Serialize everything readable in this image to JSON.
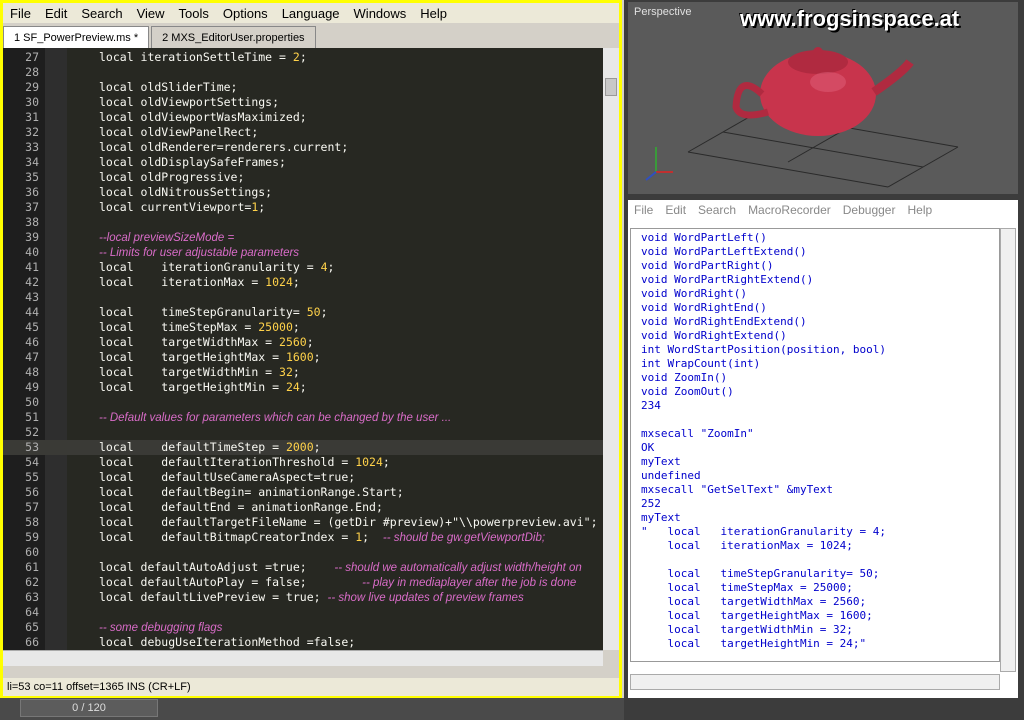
{
  "menubar": [
    "File",
    "Edit",
    "Search",
    "View",
    "Tools",
    "Options",
    "Language",
    "Windows",
    "Help"
  ],
  "tabs": [
    {
      "label": "1 SF_PowerPreview.ms *"
    },
    {
      "label": "2 MXS_EditorUser.properties"
    }
  ],
  "editor_lines": [
    {
      "n": "27",
      "c": "local iterationSettleTime = 2;"
    },
    {
      "n": "28",
      "c": ""
    },
    {
      "n": "29",
      "c": "local oldSliderTime;"
    },
    {
      "n": "30",
      "c": "local oldViewportSettings;"
    },
    {
      "n": "31",
      "c": "local oldViewportWasMaximized;"
    },
    {
      "n": "32",
      "c": "local oldViewPanelRect;"
    },
    {
      "n": "33",
      "c": "local oldRenderer=renderers.current;"
    },
    {
      "n": "34",
      "c": "local oldDisplaySafeFrames;"
    },
    {
      "n": "35",
      "c": "local oldProgressive;"
    },
    {
      "n": "36",
      "c": "local oldNitrousSettings;"
    },
    {
      "n": "37",
      "c": "local currentViewport=1;"
    },
    {
      "n": "38",
      "c": ""
    },
    {
      "n": "39",
      "c": "--local previewSizeMode ="
    },
    {
      "n": "40",
      "c": "-- Limits for user adjustable parameters"
    },
    {
      "n": "41",
      "c": "local    iterationGranularity = 4;"
    },
    {
      "n": "42",
      "c": "local    iterationMax = 1024;"
    },
    {
      "n": "43",
      "c": ""
    },
    {
      "n": "44",
      "c": "local    timeStepGranularity= 50;"
    },
    {
      "n": "45",
      "c": "local    timeStepMax = 25000;"
    },
    {
      "n": "46",
      "c": "local    targetWidthMax = 2560;"
    },
    {
      "n": "47",
      "c": "local    targetHeightMax = 1600;"
    },
    {
      "n": "48",
      "c": "local    targetWidthMin = 32;"
    },
    {
      "n": "49",
      "c": "local    targetHeightMin = 24;"
    },
    {
      "n": "50",
      "c": ""
    },
    {
      "n": "51",
      "c": "-- Default values for parameters which can be changed by the user ..."
    },
    {
      "n": "52",
      "c": ""
    },
    {
      "n": "53",
      "c": "local    defaultTimeStep = 2000;"
    },
    {
      "n": "54",
      "c": "local    defaultIterationThreshold = 1024;"
    },
    {
      "n": "55",
      "c": "local    defaultUseCameraAspect=true;"
    },
    {
      "n": "56",
      "c": "local    defaultBegin= animationRange.Start;"
    },
    {
      "n": "57",
      "c": "local    defaultEnd = animationRange.End;"
    },
    {
      "n": "58",
      "c": "local    defaultTargetFileName = (getDir #preview)+\"\\\\powerpreview.avi\";"
    },
    {
      "n": "59",
      "c": "local    defaultBitmapCreatorIndex = 1;  -- should be gw.getViewportDib;"
    },
    {
      "n": "60",
      "c": ""
    },
    {
      "n": "61",
      "c": "local defaultAutoAdjust =true;    -- should we automatically adjust width/height on"
    },
    {
      "n": "62",
      "c": "local defaultAutoPlay = false;        -- play in mediaplayer after the job is done"
    },
    {
      "n": "63",
      "c": "local defaultLivePreview = true; -- show live updates of preview frames"
    },
    {
      "n": "64",
      "c": ""
    },
    {
      "n": "65",
      "c": "-- some debugging flags"
    },
    {
      "n": "66",
      "c": "local debugUseIterationMethod =false;"
    }
  ],
  "status": "li=53 co=11 offset=1365 INS (CR+LF)",
  "pager": "0 / 120",
  "viewport_label": "Perspective",
  "logo_text": "www.frogsinspace.at",
  "listener_menu": [
    "File",
    "Edit",
    "Search",
    "MacroRecorder",
    "Debugger",
    "Help"
  ],
  "listener_lines": [
    "void WordPartLeft()",
    "void WordPartLeftExtend()",
    "void WordPartRight()",
    "void WordPartRightExtend()",
    "void WordRight()",
    "void WordRightEnd()",
    "void WordRightEndExtend()",
    "void WordRightExtend()",
    "int WordStartPosition(position, bool)",
    "int WrapCount(int)",
    "void ZoomIn()",
    "void ZoomOut()",
    "234",
    "",
    "mxsecall \"ZoomIn\"",
    "OK",
    "myText",
    "undefined",
    "mxsecall \"GetSelText\" &myText",
    "252",
    "myText",
    "\"   local   iterationGranularity = 4;",
    "    local   iterationMax = 1024;",
    "",
    "    local   timeStepGranularity= 50;",
    "    local   timeStepMax = 25000;",
    "    local   targetWidthMax = 2560;",
    "    local   targetHeightMax = 1600;",
    "    local   targetWidthMin = 32;",
    "    local   targetHeightMin = 24;\""
  ],
  "colors": {
    "accent": "#ffff00",
    "editor_bg": "#272822",
    "comment": "#d96cc8",
    "number": "#ffd24a",
    "listener_text": "#0000cc"
  }
}
